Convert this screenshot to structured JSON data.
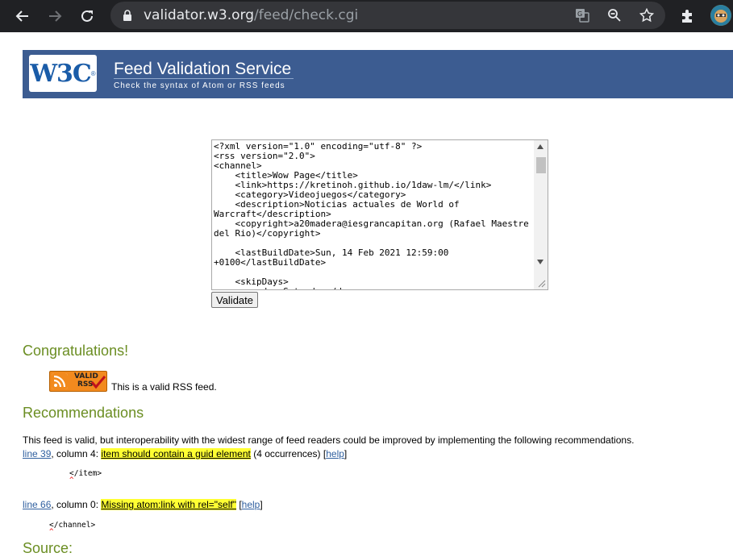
{
  "browser": {
    "url_host": "validator.w3.org",
    "url_path": "/feed/check.cgi"
  },
  "banner": {
    "logo_text": "W3C",
    "logo_mark": "®",
    "title": "Feed Validation Service",
    "subtitle": "Check the syntax of Atom or RSS feeds"
  },
  "textarea": {
    "content": "<?xml version=\"1.0\" encoding=\"utf-8\" ?>\n<rss version=\"2.0\">\n<channel>\n    <title>Wow Page</title>\n    <link>https://kretinoh.github.io/1daw-lm/</link>\n    <category>Videojuegos</category>\n    <description>Noticias actuales de World of Warcraft</description>\n    <copyright>a20madera@iesgrancapitan.org (Rafael Maestre del Rio)</copyright>\n\n    <lastBuildDate>Sun, 14 Feb 2021 12:59:00 +0100</lastBuildDate>\n\n    <skipDays>\n        <day>Saturday</day>"
  },
  "validate_label": "Validate",
  "congrats": {
    "heading": "Congratulations!",
    "badge_line1": "VALID",
    "badge_line2": "RSS",
    "valid_text": "This is a valid RSS feed."
  },
  "recommendations": {
    "heading": "Recommendations",
    "intro": "This feed is valid, but interoperability with the widest range of feed readers could be improved by implementing the following recommendations.",
    "items": [
      {
        "line_link": "line 39",
        "column": ", column 4: ",
        "message": "item should contain a guid element",
        "extra": " (4 occurrences) ",
        "help_label": "help",
        "code": "</item>",
        "caret": "^"
      },
      {
        "line_link": "line 66",
        "column": ", column 0: ",
        "message": "Missing atom:link with rel=\"self\"",
        "extra": " ",
        "help_label": "help",
        "code": "</channel>",
        "caret": "^"
      }
    ]
  },
  "source": {
    "heading": "Source:"
  },
  "colors": {
    "banner": "#3c5c91",
    "heading": "#6b8e23",
    "highlight": "#ffff33",
    "link": "#2f5f9f"
  }
}
